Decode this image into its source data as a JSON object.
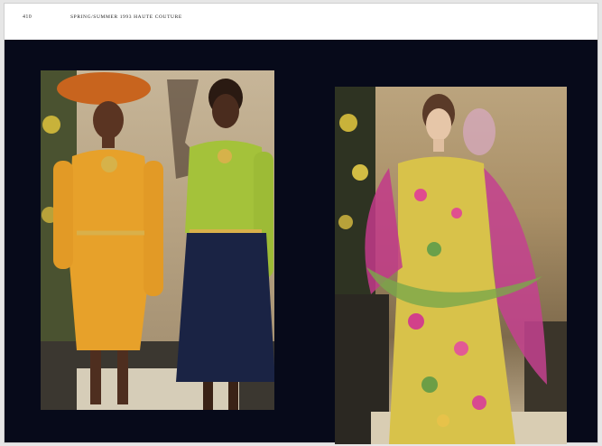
{
  "header": {
    "page_number": "410",
    "running_title": "SPRING/SUMMER 1993 HAUTE COUTURE"
  },
  "photos": [
    {
      "subject": "two-models-runway",
      "dominant_colors": [
        "#e8a42a",
        "#a9c43a",
        "#1a2344"
      ]
    },
    {
      "subject": "floral-ruffled-gown",
      "dominant_colors": [
        "#d9c14a",
        "#c43a8a",
        "#6ea04a"
      ]
    }
  ]
}
